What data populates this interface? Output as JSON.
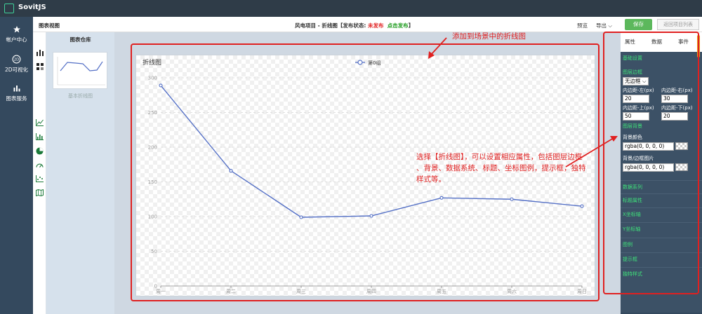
{
  "app": {
    "logo_text": "SovitJS"
  },
  "left_nav": [
    {
      "label": "帐户中心",
      "icon": "star-icon"
    },
    {
      "label": "2D可视化",
      "icon": "2d-icon"
    },
    {
      "label": "图表服务",
      "icon": "bar-chart-icon"
    }
  ],
  "toolbar": {
    "title": "图表视图",
    "project": "风电项目 - 折线图【发布状态: ",
    "status": "未发布",
    "publish_link": "点击发布",
    "close_bracket": "】",
    "preview": "预览",
    "export": "导出",
    "save": "保存",
    "back": "返回项目列表"
  },
  "library": {
    "title": "图表仓库",
    "thumb_label": "基本折线图"
  },
  "chart_data": {
    "type": "line",
    "title": "折线图",
    "series": [
      {
        "name": "第0组",
        "values": [
          289,
          166,
          99,
          101,
          127,
          125,
          115
        ]
      }
    ],
    "categories": [
      "周一",
      "周二",
      "周三",
      "周四",
      "周五",
      "周六",
      "周日"
    ],
    "ylim": [
      0,
      300
    ],
    "yticks": [
      0,
      50,
      100,
      150,
      200,
      250,
      300
    ],
    "line_color": "#5470c6",
    "grid": true,
    "legend": "top-center"
  },
  "annotations": {
    "top": "添加到场景中的折线图",
    "middle": "选择【折线图】，可以设置相应属性，包括图层边框 、背景、数据系统、标题、坐标图例，提示框，独特样式等。",
    "color": "#e02020"
  },
  "right_panel": {
    "tabs": [
      "属性",
      "数据",
      "事件"
    ],
    "basic_settings": "基础设置",
    "border_label": "图层边框",
    "border_value": "无边框",
    "pad_left_label": "内边距-左(px)",
    "pad_left_value": "20",
    "pad_right_label": "内边距-右(px)",
    "pad_right_value": "30",
    "pad_top_label": "内边距-上(px)",
    "pad_top_value": "50",
    "pad_bottom_label": "内边距-下(px)",
    "pad_bottom_value": "20",
    "bg_section": "图层背景",
    "bg_color_label": "背景颜色",
    "bg_color_value": "rgba(0, 0, 0, 0)",
    "bg_image_label": "背景/边框图片",
    "bg_image_value": "rgba(0, 0, 0, 0)",
    "sections": [
      "数据系列",
      "标题属性",
      "X坐标轴",
      "Y坐标轴",
      "图例",
      "提示框",
      "独特样式"
    ]
  }
}
